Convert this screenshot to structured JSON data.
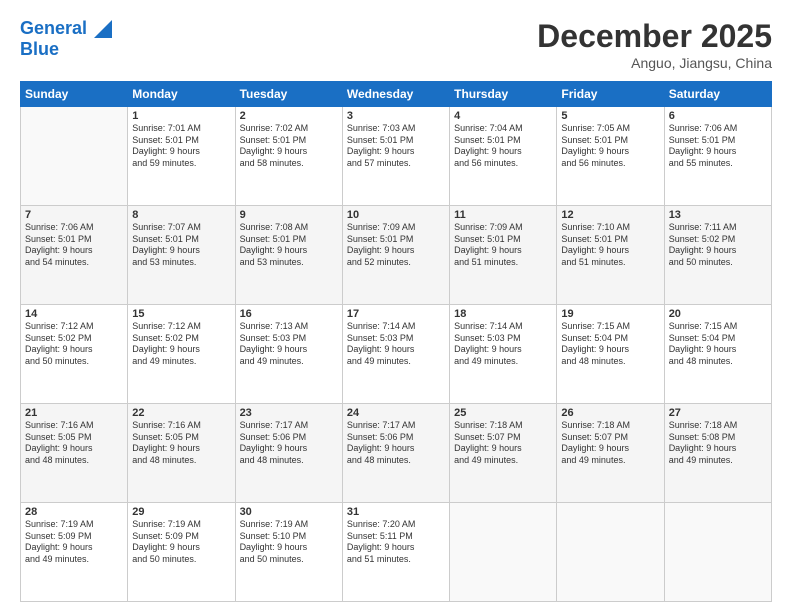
{
  "header": {
    "logo_line1": "General",
    "logo_line2": "Blue",
    "month": "December 2025",
    "location": "Anguo, Jiangsu, China"
  },
  "weekdays": [
    "Sunday",
    "Monday",
    "Tuesday",
    "Wednesday",
    "Thursday",
    "Friday",
    "Saturday"
  ],
  "weeks": [
    [
      {
        "day": "",
        "info": ""
      },
      {
        "day": "1",
        "info": "Sunrise: 7:01 AM\nSunset: 5:01 PM\nDaylight: 9 hours\nand 59 minutes."
      },
      {
        "day": "2",
        "info": "Sunrise: 7:02 AM\nSunset: 5:01 PM\nDaylight: 9 hours\nand 58 minutes."
      },
      {
        "day": "3",
        "info": "Sunrise: 7:03 AM\nSunset: 5:01 PM\nDaylight: 9 hours\nand 57 minutes."
      },
      {
        "day": "4",
        "info": "Sunrise: 7:04 AM\nSunset: 5:01 PM\nDaylight: 9 hours\nand 56 minutes."
      },
      {
        "day": "5",
        "info": "Sunrise: 7:05 AM\nSunset: 5:01 PM\nDaylight: 9 hours\nand 56 minutes."
      },
      {
        "day": "6",
        "info": "Sunrise: 7:06 AM\nSunset: 5:01 PM\nDaylight: 9 hours\nand 55 minutes."
      }
    ],
    [
      {
        "day": "7",
        "info": "Sunrise: 7:06 AM\nSunset: 5:01 PM\nDaylight: 9 hours\nand 54 minutes."
      },
      {
        "day": "8",
        "info": "Sunrise: 7:07 AM\nSunset: 5:01 PM\nDaylight: 9 hours\nand 53 minutes."
      },
      {
        "day": "9",
        "info": "Sunrise: 7:08 AM\nSunset: 5:01 PM\nDaylight: 9 hours\nand 53 minutes."
      },
      {
        "day": "10",
        "info": "Sunrise: 7:09 AM\nSunset: 5:01 PM\nDaylight: 9 hours\nand 52 minutes."
      },
      {
        "day": "11",
        "info": "Sunrise: 7:09 AM\nSunset: 5:01 PM\nDaylight: 9 hours\nand 51 minutes."
      },
      {
        "day": "12",
        "info": "Sunrise: 7:10 AM\nSunset: 5:01 PM\nDaylight: 9 hours\nand 51 minutes."
      },
      {
        "day": "13",
        "info": "Sunrise: 7:11 AM\nSunset: 5:02 PM\nDaylight: 9 hours\nand 50 minutes."
      }
    ],
    [
      {
        "day": "14",
        "info": "Sunrise: 7:12 AM\nSunset: 5:02 PM\nDaylight: 9 hours\nand 50 minutes."
      },
      {
        "day": "15",
        "info": "Sunrise: 7:12 AM\nSunset: 5:02 PM\nDaylight: 9 hours\nand 49 minutes."
      },
      {
        "day": "16",
        "info": "Sunrise: 7:13 AM\nSunset: 5:03 PM\nDaylight: 9 hours\nand 49 minutes."
      },
      {
        "day": "17",
        "info": "Sunrise: 7:14 AM\nSunset: 5:03 PM\nDaylight: 9 hours\nand 49 minutes."
      },
      {
        "day": "18",
        "info": "Sunrise: 7:14 AM\nSunset: 5:03 PM\nDaylight: 9 hours\nand 49 minutes."
      },
      {
        "day": "19",
        "info": "Sunrise: 7:15 AM\nSunset: 5:04 PM\nDaylight: 9 hours\nand 48 minutes."
      },
      {
        "day": "20",
        "info": "Sunrise: 7:15 AM\nSunset: 5:04 PM\nDaylight: 9 hours\nand 48 minutes."
      }
    ],
    [
      {
        "day": "21",
        "info": "Sunrise: 7:16 AM\nSunset: 5:05 PM\nDaylight: 9 hours\nand 48 minutes."
      },
      {
        "day": "22",
        "info": "Sunrise: 7:16 AM\nSunset: 5:05 PM\nDaylight: 9 hours\nand 48 minutes."
      },
      {
        "day": "23",
        "info": "Sunrise: 7:17 AM\nSunset: 5:06 PM\nDaylight: 9 hours\nand 48 minutes."
      },
      {
        "day": "24",
        "info": "Sunrise: 7:17 AM\nSunset: 5:06 PM\nDaylight: 9 hours\nand 48 minutes."
      },
      {
        "day": "25",
        "info": "Sunrise: 7:18 AM\nSunset: 5:07 PM\nDaylight: 9 hours\nand 49 minutes."
      },
      {
        "day": "26",
        "info": "Sunrise: 7:18 AM\nSunset: 5:07 PM\nDaylight: 9 hours\nand 49 minutes."
      },
      {
        "day": "27",
        "info": "Sunrise: 7:18 AM\nSunset: 5:08 PM\nDaylight: 9 hours\nand 49 minutes."
      }
    ],
    [
      {
        "day": "28",
        "info": "Sunrise: 7:19 AM\nSunset: 5:09 PM\nDaylight: 9 hours\nand 49 minutes."
      },
      {
        "day": "29",
        "info": "Sunrise: 7:19 AM\nSunset: 5:09 PM\nDaylight: 9 hours\nand 50 minutes."
      },
      {
        "day": "30",
        "info": "Sunrise: 7:19 AM\nSunset: 5:10 PM\nDaylight: 9 hours\nand 50 minutes."
      },
      {
        "day": "31",
        "info": "Sunrise: 7:20 AM\nSunset: 5:11 PM\nDaylight: 9 hours\nand 51 minutes."
      },
      {
        "day": "",
        "info": ""
      },
      {
        "day": "",
        "info": ""
      },
      {
        "day": "",
        "info": ""
      }
    ]
  ]
}
